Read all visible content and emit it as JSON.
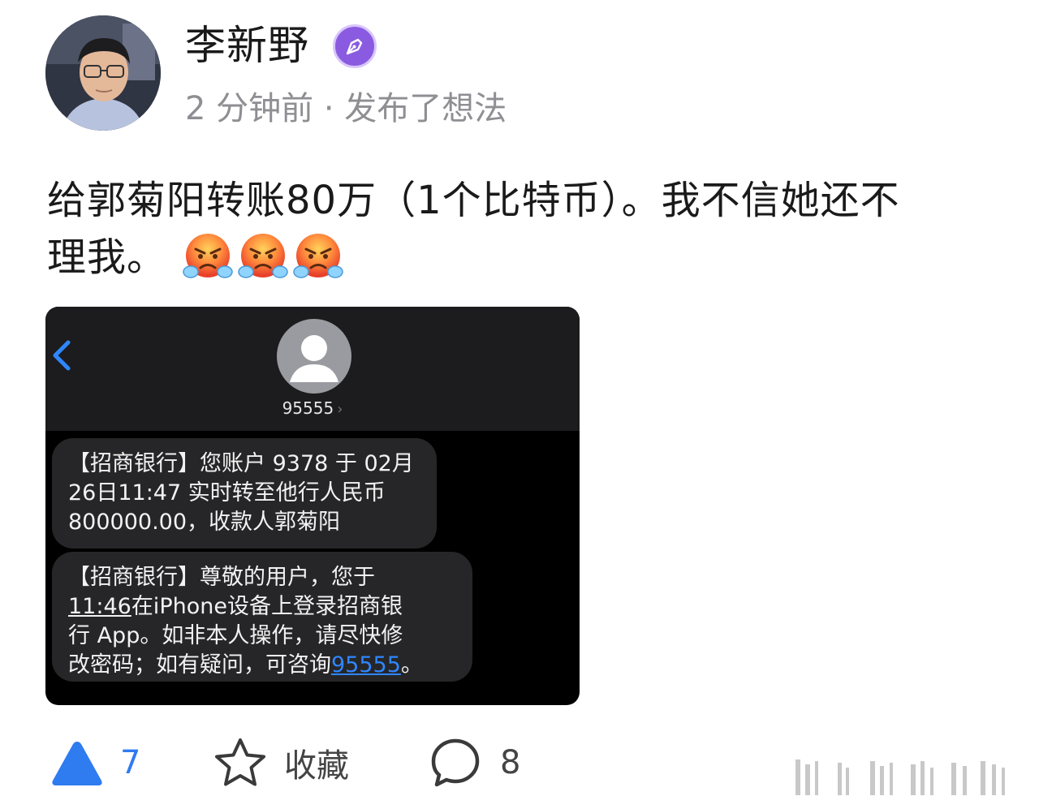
{
  "author": {
    "name": "李新野",
    "badge_icon": "pen-nib-icon",
    "meta": "2 分钟前 · 发布了想法"
  },
  "post": {
    "text_line1": "给郭菊阳转账80万（1个比特币）。我不信她还不",
    "text_line2": "理我。",
    "emojis": [
      "angry-face-steam-emoji",
      "angry-face-steam-emoji",
      "angry-face-steam-emoji"
    ]
  },
  "screenshot": {
    "contact": "95555",
    "messages": [
      {
        "part1": "【招商银行】您账户 9378 于 02月",
        "part2": "26日11:47 实时转至他行人民币",
        "part3": "800000.00，收款人郭菊阳"
      },
      {
        "part1": "【招商银行】尊敬的用户，您于",
        "time": "11:46",
        "part2": "在iPhone设备上登录招商银",
        "part3": "行 App。如非本人操作，请尽快修",
        "part4": "改密码；如有疑问，可咨询",
        "link": "95555",
        "end": "。"
      }
    ],
    "colors": {
      "background": "#000000",
      "bubble": "#262628",
      "link": "#2f86ff",
      "back": "#2f86ff"
    }
  },
  "actions": {
    "like_count": "7",
    "favorite_label": "收藏",
    "comment_count": "8"
  },
  "colors": {
    "accent": "#2f7bf0",
    "badge": "#8a5be0",
    "meta_text": "#8e8e93"
  }
}
